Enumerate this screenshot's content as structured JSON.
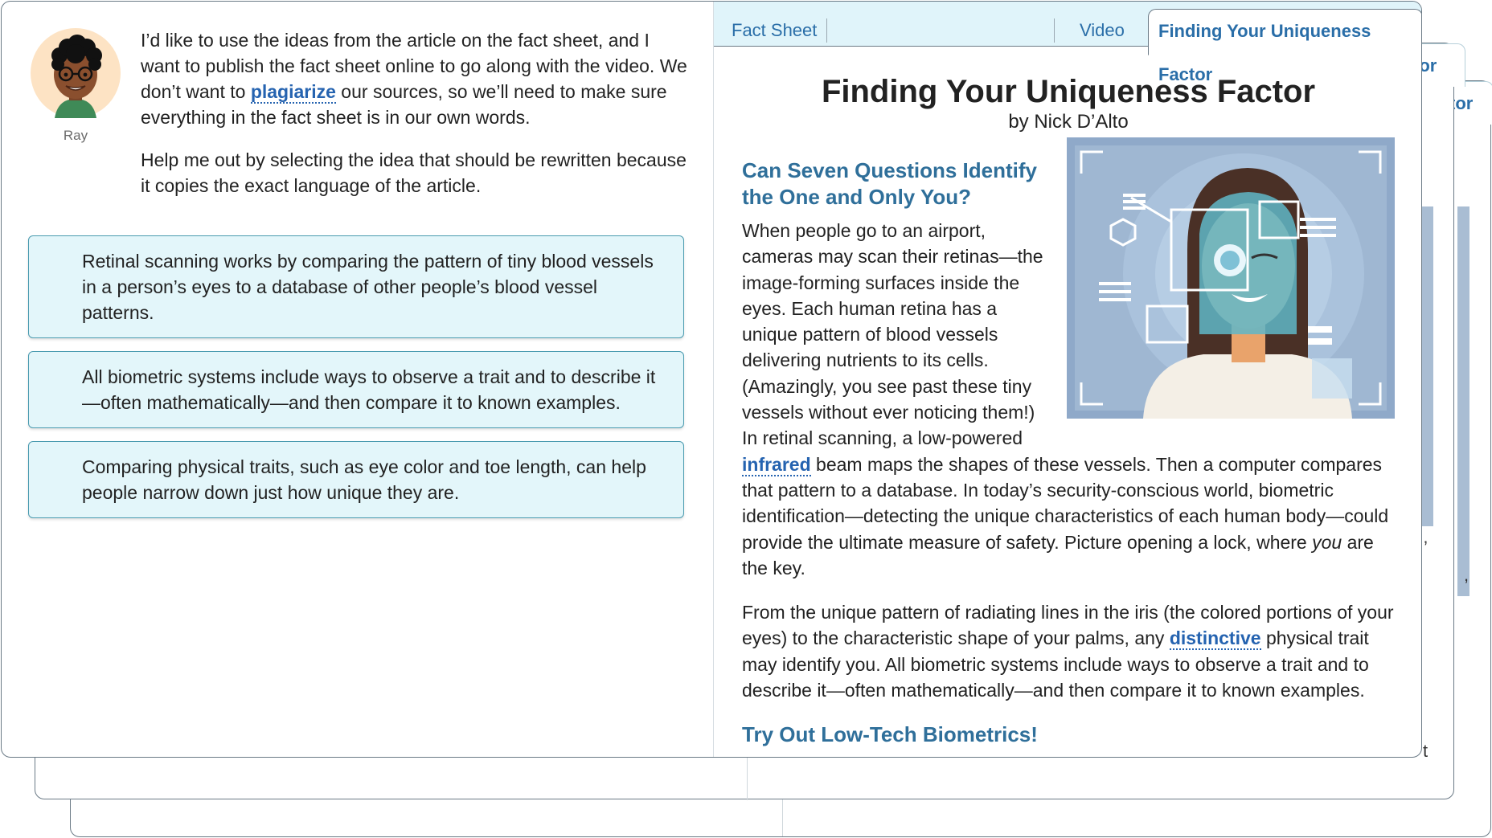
{
  "speaker": {
    "name": "Ray",
    "message_part1": "I’d like to use the ideas from the article on the fact sheet, and I want to publish the fact sheet online to go along with the video. We don’t want to ",
    "glossary_word": "plagiarize",
    "message_part2": " our sources, so we’ll need to make sure everything in the fact sheet is in our own words.",
    "instruction": "Help me out by selecting the idea that should be rewritten because it copies the exact language of the article."
  },
  "choices": [
    "Retinal scanning works by comparing the pattern of tiny blood vessels in a person’s eyes to a database of other people’s blood vessel patterns.",
    "All biometric systems include ways to observe a trait and to describe it—often mathematically—and then compare it to known examples.",
    "Comparing physical traits, such as eye color and toe length, can help people narrow down just how unique they are."
  ],
  "tabs": {
    "fact_sheet": "Fact Sheet",
    "video": "Video",
    "article": "Finding Your Uniqueness Factor"
  },
  "back_cards": {
    "tab1_fragment": "tor",
    "tab2_fragment": "tor",
    "text_fragments": [
      "’",
      ",",
      "t",
      "t"
    ]
  },
  "article": {
    "title": "Finding Your Uniqueness Factor",
    "author": "by Nick D’Alto",
    "heading1": "Can Seven Questions Identify the One and Only You?",
    "p1_a": "When people go to an airport, cameras may scan their retinas—the image-forming surfaces inside the eyes. Each human retina has a unique pattern of blood vessels delivering nutrients to its cells. (Amazingly, you see past these tiny vessels without ever noticing them!) In retinal scanning, a low-powered ",
    "p1_word": "infrared",
    "p1_b": " beam maps the shapes of these vessels. Then a computer compares that pattern to a database. In today’s security-conscious world, biometric identification—detecting the unique characteristics of each human body—could provide the ultimate measure of safety. Picture opening a lock, where ",
    "p1_em": "you",
    "p1_c": " are the key.",
    "p2_a": "From the unique pattern of radiating lines in the iris (the colored portions of your eyes) to the characteristic shape of your palms, any ",
    "p2_word": "distinctive",
    "p2_b": " physical trait may identify you. All biometric systems include ways to observe a trait and to describe it—often mathematically—and then compare it to known examples.",
    "heading2": "Try Out Low-Tech Biometrics!"
  },
  "colors": {
    "accent_blue": "#2a6ea8",
    "heading_blue": "#2f6f9a",
    "choice_bg": "#e3f6fa",
    "choice_border": "#4a9bb0",
    "tabbar_bg": "#e0f4fa"
  }
}
